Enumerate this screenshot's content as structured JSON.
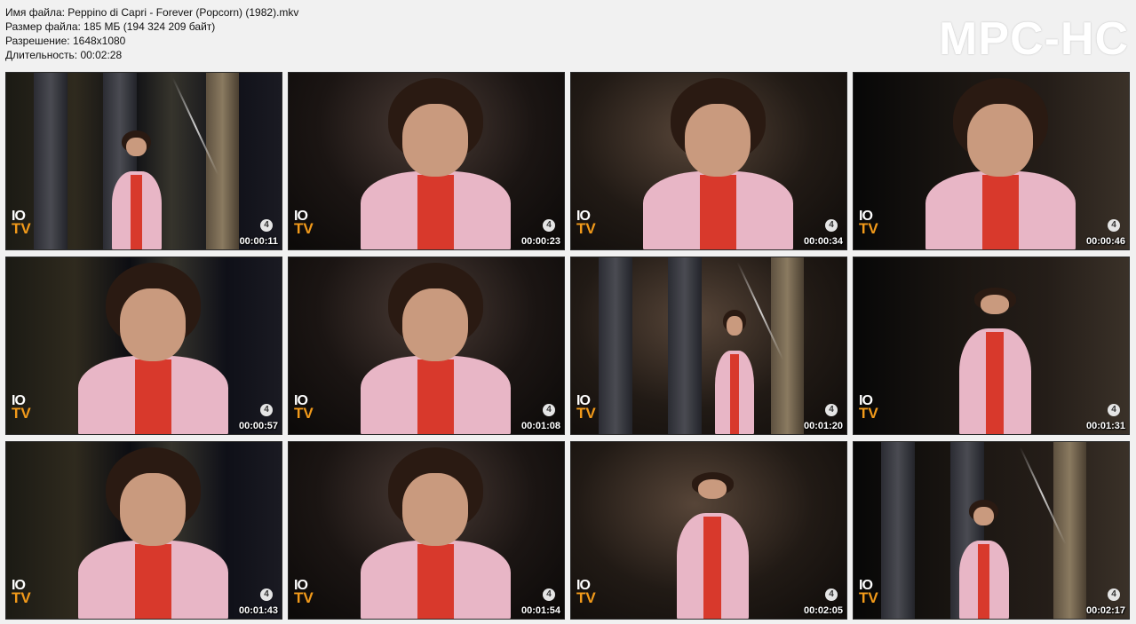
{
  "info": {
    "filename": "Имя файла: Peppino di Capri - Forever (Popcorn) (1982).mkv",
    "filesize": "Размер файла: 185 МБ (194 324 209 байт)",
    "resolution": "Разрешение: 1648x1080",
    "duration": "Длительность: 00:02:28"
  },
  "logo": "MPC-HC",
  "channel": {
    "top": "IO",
    "bottom": "TV",
    "bug": "4"
  },
  "thumbnails": [
    {
      "timestamp": "00:00:11",
      "shot": "wide"
    },
    {
      "timestamp": "00:00:23",
      "shot": "close"
    },
    {
      "timestamp": "00:00:34",
      "shot": "close"
    },
    {
      "timestamp": "00:00:46",
      "shot": "close"
    },
    {
      "timestamp": "00:00:57",
      "shot": "close"
    },
    {
      "timestamp": "00:01:08",
      "shot": "close"
    },
    {
      "timestamp": "00:01:20",
      "shot": "pillar"
    },
    {
      "timestamp": "00:01:31",
      "shot": "medium"
    },
    {
      "timestamp": "00:01:43",
      "shot": "close"
    },
    {
      "timestamp": "00:01:54",
      "shot": "close"
    },
    {
      "timestamp": "00:02:05",
      "shot": "medium"
    },
    {
      "timestamp": "00:02:17",
      "shot": "wide"
    }
  ],
  "colors": {
    "background": "#f1f1f1",
    "jacket": "#e8b6c6",
    "shirt": "#d8392c",
    "channel_accent": "#f29a1a"
  }
}
